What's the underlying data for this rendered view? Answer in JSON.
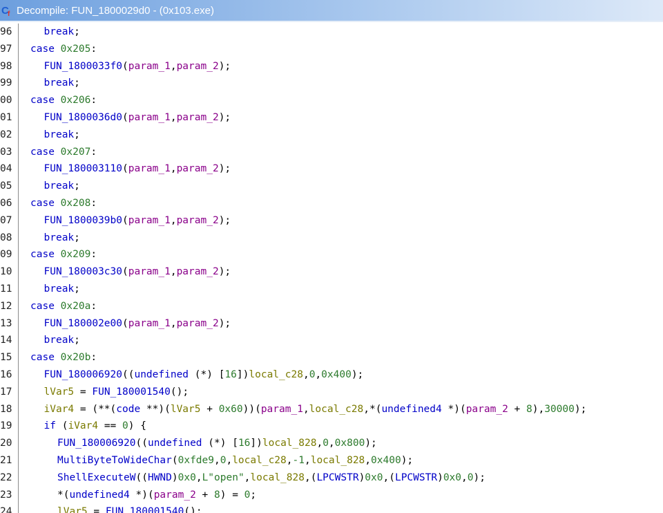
{
  "window": {
    "title": "Decompile: FUN_1800029d0 - (0x103.exe)",
    "icon": "ghidra-decompile-icon"
  },
  "colors": {
    "keyword": "#0000c8",
    "function": "#0000c8",
    "param": "#8a008a",
    "local": "#7a7a00",
    "number": "#2c7a2c"
  },
  "lines": [
    {
      "n": "96",
      "i": 1,
      "t": [
        [
          "kw",
          "break"
        ],
        [
          "pl",
          ";"
        ]
      ]
    },
    {
      "n": "97",
      "i": 0,
      "t": [
        [
          "kw",
          "case"
        ],
        [
          "pl",
          " "
        ],
        [
          "nm",
          "0x205"
        ],
        [
          "pl",
          ":"
        ]
      ]
    },
    {
      "n": "98",
      "i": 1,
      "t": [
        [
          "fn",
          "FUN_1800033f0"
        ],
        [
          "pl",
          "("
        ],
        [
          "pa",
          "param_1"
        ],
        [
          "pl",
          ","
        ],
        [
          "pa",
          "param_2"
        ],
        [
          "pl",
          ");"
        ]
      ]
    },
    {
      "n": "99",
      "i": 1,
      "t": [
        [
          "kw",
          "break"
        ],
        [
          "pl",
          ";"
        ]
      ]
    },
    {
      "n": "00",
      "i": 0,
      "t": [
        [
          "kw",
          "case"
        ],
        [
          "pl",
          " "
        ],
        [
          "nm",
          "0x206"
        ],
        [
          "pl",
          ":"
        ]
      ]
    },
    {
      "n": "01",
      "i": 1,
      "t": [
        [
          "fn",
          "FUN_1800036d0"
        ],
        [
          "pl",
          "("
        ],
        [
          "pa",
          "param_1"
        ],
        [
          "pl",
          ","
        ],
        [
          "pa",
          "param_2"
        ],
        [
          "pl",
          ");"
        ]
      ]
    },
    {
      "n": "02",
      "i": 1,
      "t": [
        [
          "kw",
          "break"
        ],
        [
          "pl",
          ";"
        ]
      ]
    },
    {
      "n": "03",
      "i": 0,
      "t": [
        [
          "kw",
          "case"
        ],
        [
          "pl",
          " "
        ],
        [
          "nm",
          "0x207"
        ],
        [
          "pl",
          ":"
        ]
      ]
    },
    {
      "n": "04",
      "i": 1,
      "t": [
        [
          "fn",
          "FUN_180003110"
        ],
        [
          "pl",
          "("
        ],
        [
          "pa",
          "param_1"
        ],
        [
          "pl",
          ","
        ],
        [
          "pa",
          "param_2"
        ],
        [
          "pl",
          ");"
        ]
      ]
    },
    {
      "n": "05",
      "i": 1,
      "t": [
        [
          "kw",
          "break"
        ],
        [
          "pl",
          ";"
        ]
      ]
    },
    {
      "n": "06",
      "i": 0,
      "t": [
        [
          "kw",
          "case"
        ],
        [
          "pl",
          " "
        ],
        [
          "nm",
          "0x208"
        ],
        [
          "pl",
          ":"
        ]
      ]
    },
    {
      "n": "07",
      "i": 1,
      "t": [
        [
          "fn",
          "FUN_1800039b0"
        ],
        [
          "pl",
          "("
        ],
        [
          "pa",
          "param_1"
        ],
        [
          "pl",
          ","
        ],
        [
          "pa",
          "param_2"
        ],
        [
          "pl",
          ");"
        ]
      ]
    },
    {
      "n": "08",
      "i": 1,
      "t": [
        [
          "kw",
          "break"
        ],
        [
          "pl",
          ";"
        ]
      ]
    },
    {
      "n": "09",
      "i": 0,
      "t": [
        [
          "kw",
          "case"
        ],
        [
          "pl",
          " "
        ],
        [
          "nm",
          "0x209"
        ],
        [
          "pl",
          ":"
        ]
      ]
    },
    {
      "n": "10",
      "i": 1,
      "t": [
        [
          "fn",
          "FUN_180003c30"
        ],
        [
          "pl",
          "("
        ],
        [
          "pa",
          "param_1"
        ],
        [
          "pl",
          ","
        ],
        [
          "pa",
          "param_2"
        ],
        [
          "pl",
          ");"
        ]
      ]
    },
    {
      "n": "11",
      "i": 1,
      "t": [
        [
          "kw",
          "break"
        ],
        [
          "pl",
          ";"
        ]
      ]
    },
    {
      "n": "12",
      "i": 0,
      "t": [
        [
          "kw",
          "case"
        ],
        [
          "pl",
          " "
        ],
        [
          "nm",
          "0x20a"
        ],
        [
          "pl",
          ":"
        ]
      ]
    },
    {
      "n": "13",
      "i": 1,
      "t": [
        [
          "fn",
          "FUN_180002e00"
        ],
        [
          "pl",
          "("
        ],
        [
          "pa",
          "param_1"
        ],
        [
          "pl",
          ","
        ],
        [
          "pa",
          "param_2"
        ],
        [
          "pl",
          ");"
        ]
      ]
    },
    {
      "n": "14",
      "i": 1,
      "t": [
        [
          "kw",
          "break"
        ],
        [
          "pl",
          ";"
        ]
      ]
    },
    {
      "n": "15",
      "i": 0,
      "t": [
        [
          "kw",
          "case"
        ],
        [
          "pl",
          " "
        ],
        [
          "nm",
          "0x20b"
        ],
        [
          "pl",
          ":"
        ]
      ]
    },
    {
      "n": "16",
      "i": 1,
      "t": [
        [
          "fn",
          "FUN_180006920"
        ],
        [
          "pl",
          "(("
        ],
        [
          "ty",
          "undefined"
        ],
        [
          "pl",
          " (*) ["
        ],
        [
          "nm",
          "16"
        ],
        [
          "pl",
          "])"
        ],
        [
          "lv",
          "local_c28"
        ],
        [
          "pl",
          ","
        ],
        [
          "nm",
          "0"
        ],
        [
          "pl",
          ","
        ],
        [
          "nm",
          "0x400"
        ],
        [
          "pl",
          ");"
        ]
      ]
    },
    {
      "n": "17",
      "i": 1,
      "t": [
        [
          "lv",
          "lVar5"
        ],
        [
          "pl",
          " = "
        ],
        [
          "fn",
          "FUN_180001540"
        ],
        [
          "pl",
          "();"
        ]
      ]
    },
    {
      "n": "18",
      "i": 1,
      "t": [
        [
          "lv",
          "iVar4"
        ],
        [
          "pl",
          " = (**("
        ],
        [
          "ty",
          "code"
        ],
        [
          "pl",
          " **)("
        ],
        [
          "lv",
          "lVar5"
        ],
        [
          "pl",
          " + "
        ],
        [
          "nm",
          "0x60"
        ],
        [
          "pl",
          "))("
        ],
        [
          "pa",
          "param_1"
        ],
        [
          "pl",
          ","
        ],
        [
          "lv",
          "local_c28"
        ],
        [
          "pl",
          ",*("
        ],
        [
          "ty",
          "undefined4"
        ],
        [
          "pl",
          " *)("
        ],
        [
          "pa",
          "param_2"
        ],
        [
          "pl",
          " + "
        ],
        [
          "nm",
          "8"
        ],
        [
          "pl",
          "),"
        ],
        [
          "nm",
          "30000"
        ],
        [
          "pl",
          ");"
        ]
      ]
    },
    {
      "n": "19",
      "i": 1,
      "t": [
        [
          "kw",
          "if"
        ],
        [
          "pl",
          " ("
        ],
        [
          "lv",
          "iVar4"
        ],
        [
          "pl",
          " == "
        ],
        [
          "nm",
          "0"
        ],
        [
          "pl",
          ") {"
        ]
      ]
    },
    {
      "n": "20",
      "i": 2,
      "t": [
        [
          "fn",
          "FUN_180006920"
        ],
        [
          "pl",
          "(("
        ],
        [
          "ty",
          "undefined"
        ],
        [
          "pl",
          " (*) ["
        ],
        [
          "nm",
          "16"
        ],
        [
          "pl",
          "])"
        ],
        [
          "lv",
          "local_828"
        ],
        [
          "pl",
          ","
        ],
        [
          "nm",
          "0"
        ],
        [
          "pl",
          ","
        ],
        [
          "nm",
          "0x800"
        ],
        [
          "pl",
          ");"
        ]
      ]
    },
    {
      "n": "21",
      "i": 2,
      "t": [
        [
          "fn",
          "MultiByteToWideChar"
        ],
        [
          "pl",
          "("
        ],
        [
          "nm",
          "0xfde9"
        ],
        [
          "pl",
          ","
        ],
        [
          "nm",
          "0"
        ],
        [
          "pl",
          ","
        ],
        [
          "lv",
          "local_c28"
        ],
        [
          "pl",
          ","
        ],
        [
          "nm",
          "-1"
        ],
        [
          "pl",
          ","
        ],
        [
          "lv",
          "local_828"
        ],
        [
          "pl",
          ","
        ],
        [
          "nm",
          "0x400"
        ],
        [
          "pl",
          ");"
        ]
      ]
    },
    {
      "n": "22",
      "i": 2,
      "t": [
        [
          "fn",
          "ShellExecuteW"
        ],
        [
          "pl",
          "(("
        ],
        [
          "ty",
          "HWND"
        ],
        [
          "pl",
          ")"
        ],
        [
          "nm",
          "0x0"
        ],
        [
          "pl",
          ","
        ],
        [
          "st",
          "L\"open\""
        ],
        [
          "pl",
          ","
        ],
        [
          "lv",
          "local_828"
        ],
        [
          "pl",
          ",("
        ],
        [
          "ty",
          "LPCWSTR"
        ],
        [
          "pl",
          ")"
        ],
        [
          "nm",
          "0x0"
        ],
        [
          "pl",
          ",("
        ],
        [
          "ty",
          "LPCWSTR"
        ],
        [
          "pl",
          ")"
        ],
        [
          "nm",
          "0x0"
        ],
        [
          "pl",
          ","
        ],
        [
          "nm",
          "0"
        ],
        [
          "pl",
          ");"
        ]
      ]
    },
    {
      "n": "23",
      "i": 2,
      "t": [
        [
          "pl",
          "*("
        ],
        [
          "ty",
          "undefined4"
        ],
        [
          "pl",
          " *)("
        ],
        [
          "pa",
          "param_2"
        ],
        [
          "pl",
          " + "
        ],
        [
          "nm",
          "8"
        ],
        [
          "pl",
          ") = "
        ],
        [
          "nm",
          "0"
        ],
        [
          "pl",
          ";"
        ]
      ]
    },
    {
      "n": "24",
      "i": 2,
      "t": [
        [
          "lv",
          "lVar5"
        ],
        [
          "pl",
          " = "
        ],
        [
          "fn",
          "FUN_180001540"
        ],
        [
          "pl",
          "();"
        ]
      ]
    }
  ]
}
